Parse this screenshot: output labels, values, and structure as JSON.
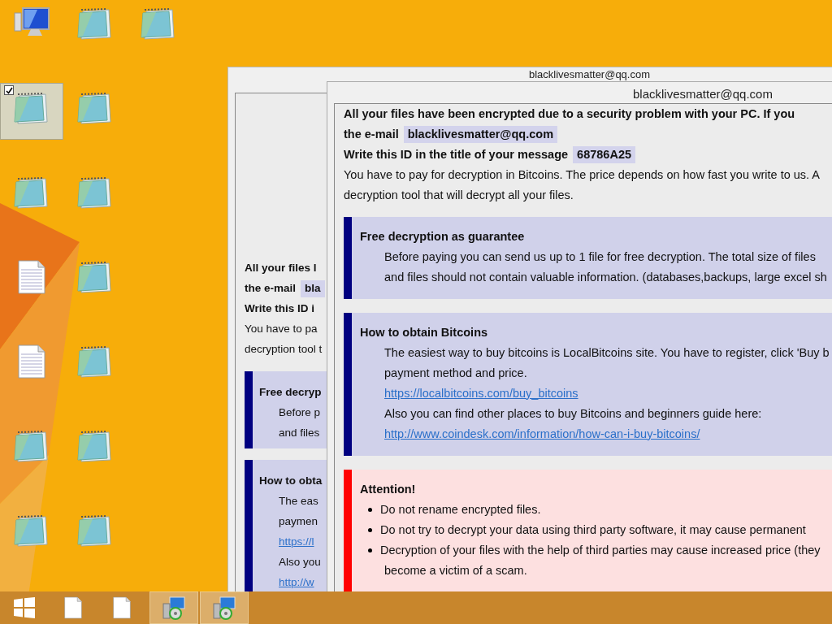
{
  "desktop": {
    "icons": [
      {
        "kind": "computer",
        "selected": false
      },
      {
        "kind": "notepad",
        "selected": false
      },
      {
        "kind": "notepad",
        "selected": false
      },
      {
        "kind": "notepad",
        "selected": true
      },
      {
        "kind": "notepad",
        "selected": false
      },
      {
        "kind": "notepad",
        "selected": false
      },
      {
        "kind": "notepad",
        "selected": false
      },
      {
        "kind": "textfile",
        "selected": false
      },
      {
        "kind": "notepad",
        "selected": false
      },
      {
        "kind": "textfile",
        "selected": false
      },
      {
        "kind": "notepad",
        "selected": false
      },
      {
        "kind": "notepad",
        "selected": false
      },
      {
        "kind": "notepad",
        "selected": false
      },
      {
        "kind": "notepad",
        "selected": false
      },
      {
        "kind": "notepad",
        "selected": false
      }
    ]
  },
  "back_window": {
    "title": "blacklivesmatter@qq.com",
    "intro": [
      {
        "text": "All your files l",
        "bold": true
      },
      {
        "text": "the e-mail",
        "bold": true,
        "highlight": "bla"
      },
      {
        "text": "Write this ID i",
        "bold": true
      },
      {
        "text": "You have to pa",
        "bold": false
      },
      {
        "text": "decryption tool t",
        "bold": false
      }
    ],
    "sections": [
      {
        "kind": "info",
        "heading": "Free decryp",
        "lines": [
          {
            "kind": "text",
            "text": "Before p"
          },
          {
            "kind": "text",
            "text": "and files"
          }
        ]
      },
      {
        "kind": "info",
        "heading": "How to obta",
        "lines": [
          {
            "kind": "text",
            "text": "The eas"
          },
          {
            "kind": "text",
            "text": "paymen"
          },
          {
            "kind": "link",
            "text": "https://l"
          },
          {
            "kind": "text",
            "text": "Also you"
          },
          {
            "kind": "link",
            "text": "http://w"
          }
        ]
      }
    ]
  },
  "front_window": {
    "title": "blacklivesmatter@qq.com",
    "intro": [
      {
        "text": "All your files have been encrypted due to a security problem with your PC. If you",
        "bold": true
      },
      {
        "text": "the e-mail",
        "bold": true,
        "highlight": "blacklivesmatter@qq.com"
      },
      {
        "text": "Write this ID in the title of your message",
        "bold": true,
        "highlight": "68786A25"
      },
      {
        "text": "You have to pay for decryption in Bitcoins. The price depends on how fast you write to us. A",
        "bold": false
      },
      {
        "text": "decryption tool that will decrypt all your files.",
        "bold": false
      }
    ],
    "sections": [
      {
        "kind": "info",
        "heading": "Free decryption as guarantee",
        "lines": [
          {
            "kind": "text",
            "text": "Before paying you can send us up to 1 file for free decryption. The total size of files"
          },
          {
            "kind": "text",
            "text": "and files should not contain valuable information. (databases,backups, large excel sh"
          }
        ]
      },
      {
        "kind": "info",
        "heading": "How to obtain Bitcoins",
        "lines": [
          {
            "kind": "text",
            "text": "The easiest way to buy bitcoins is LocalBitcoins site. You have to register, click 'Buy b"
          },
          {
            "kind": "text",
            "text": "payment method and price."
          },
          {
            "kind": "link",
            "text": "https://localbitcoins.com/buy_bitcoins"
          },
          {
            "kind": "text",
            "text": "Also you can find other places to buy Bitcoins and beginners guide here:"
          },
          {
            "kind": "link",
            "text": "http://www.coindesk.com/information/how-can-i-buy-bitcoins/"
          }
        ]
      },
      {
        "kind": "alert",
        "heading": "Attention!",
        "lines": [
          {
            "kind": "bullet",
            "text": "Do not rename encrypted files."
          },
          {
            "kind": "bullet",
            "text": "Do not try to decrypt your data using third party software, it may cause permanent"
          },
          {
            "kind": "bullet",
            "text": "Decryption of your files with the help of third parties may cause increased price (they"
          },
          {
            "kind": "continuation",
            "text": "become a victim of a scam."
          }
        ]
      }
    ]
  },
  "taskbar": {
    "items": [
      {
        "kind": "start",
        "selected": false
      },
      {
        "kind": "file",
        "selected": false
      },
      {
        "kind": "file",
        "selected": false
      },
      {
        "kind": "installer",
        "selected": true
      },
      {
        "kind": "installer",
        "selected": true
      }
    ]
  }
}
